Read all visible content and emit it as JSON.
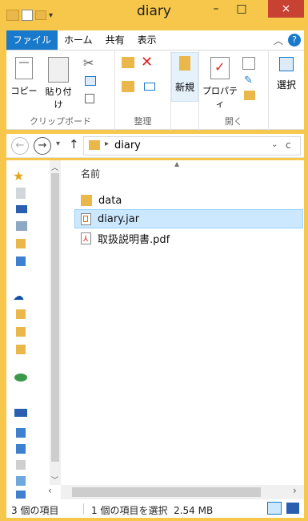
{
  "window": {
    "title": "diary",
    "minimize": "–",
    "maximize": "□",
    "close": "×"
  },
  "ribbon_tabs": {
    "file": "ファイル",
    "home": "ホーム",
    "share": "共有",
    "view": "表示"
  },
  "ribbon": {
    "copy": "コピー",
    "paste": "貼り付け",
    "clipboard_group": "クリップボード",
    "organize_group": "整理",
    "new": "新規",
    "properties": "プロパティ",
    "open_group": "開く",
    "select": "選択"
  },
  "address": {
    "path": "diary",
    "search_glyph": "c"
  },
  "content": {
    "column_name": "名前",
    "files": [
      {
        "name": "data",
        "icon": "folder-icon"
      },
      {
        "name": "diary.jar",
        "icon": "java-file-icon"
      },
      {
        "name": "取扱説明書.pdf",
        "icon": "pdf-file-icon"
      }
    ]
  },
  "status": {
    "item_count": "3 個の項目",
    "selection": "1 個の項目を選択  2.54 MB"
  },
  "colors": {
    "accent": "#1979ca",
    "frame": "#f6c74a",
    "close": "#c84233",
    "selection": "#cce8ff"
  }
}
